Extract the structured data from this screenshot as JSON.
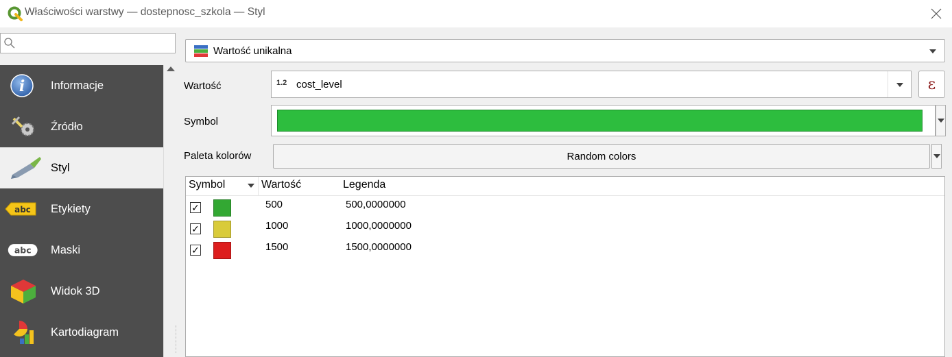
{
  "window": {
    "title": "Właściwości warstwy — dostepnosc_szkola — Styl",
    "close_symbol": "✕"
  },
  "search": {
    "placeholder": "",
    "value": ""
  },
  "sidebar": {
    "items": [
      {
        "label": "Informacje",
        "icon": "info-icon",
        "active": false
      },
      {
        "label": "Źródło",
        "icon": "source-tools-icon",
        "active": false
      },
      {
        "label": "Styl",
        "icon": "paintbrush-icon",
        "active": true
      },
      {
        "label": "Etykiety",
        "icon": "labels-abc-icon",
        "active": false
      },
      {
        "label": "Maski",
        "icon": "masks-abc-icon",
        "active": false
      },
      {
        "label": "Widok 3D",
        "icon": "cube-3d-icon",
        "active": false
      },
      {
        "label": "Kartodiagram",
        "icon": "diagram-icon",
        "active": false
      }
    ]
  },
  "renderer": {
    "label": "Wartość unikalna",
    "icon": "categorized-icon"
  },
  "fields": {
    "value_label": "Wartość",
    "value_type": "1.2",
    "value": "cost_level",
    "expression_symbol": "ε",
    "symbol_label": "Symbol",
    "symbol_color": "#2dbd3e",
    "palette_label": "Paleta kolorów",
    "palette_value": "Random colors"
  },
  "table": {
    "headers": [
      "Symbol",
      "Wartość",
      "Legenda"
    ],
    "rows": [
      {
        "checked": "✓",
        "color": "#33a833",
        "value": "500",
        "legend": "500,0000000"
      },
      {
        "checked": "✓",
        "color": "#d9cb3a",
        "value": "1000",
        "legend": "1000,0000000"
      },
      {
        "checked": "✓",
        "color": "#dd1e1e",
        "value": "1500",
        "legend": "1500,0000000"
      }
    ]
  }
}
